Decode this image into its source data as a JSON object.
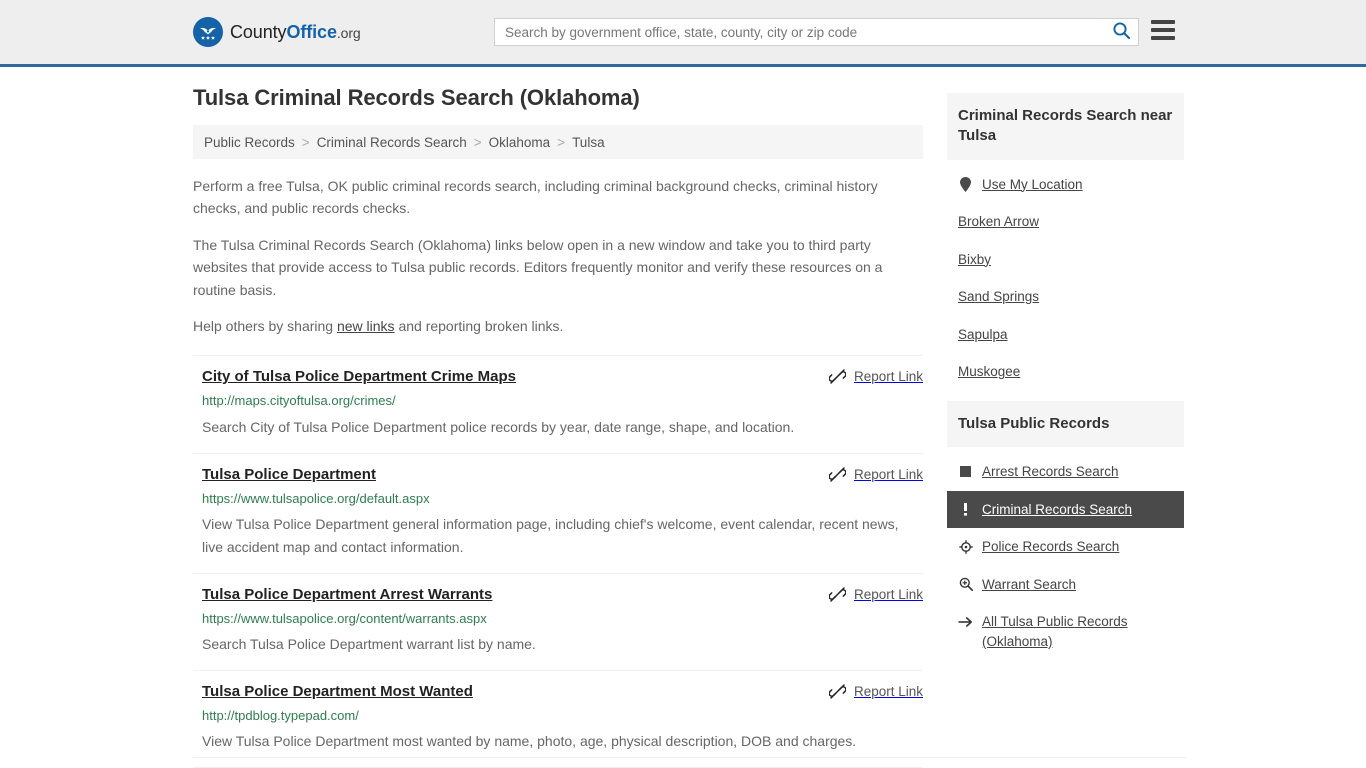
{
  "header": {
    "logo": {
      "icon": "eagle-shield-icon",
      "text_part1": "County",
      "text_part2": "Office",
      "text_part3": ".org"
    },
    "search": {
      "placeholder": "Search by government office, state, county, city or zip code",
      "value": "",
      "icon": "search-icon",
      "accent": "#1463a8"
    },
    "menu_icon": "hamburger-menu-icon",
    "background": "#eeeeee",
    "border_color": "#30699b"
  },
  "main": {
    "title": "Tulsa Criminal Records Search (Oklahoma)",
    "breadcrumb": {
      "items": [
        {
          "label": "Public Records",
          "current": false
        },
        {
          "label": "Criminal Records Search",
          "current": false
        },
        {
          "label": "Oklahoma",
          "current": false
        },
        {
          "label": "Tulsa",
          "current": true
        }
      ],
      "separator": ">"
    },
    "intro": {
      "paragraph1": "Perform a free Tulsa, OK public criminal records search, including criminal background checks, criminal history checks, and public records checks.",
      "paragraph2": "The Tulsa Criminal Records Search (Oklahoma) links below open in a new window and take you to third party websites that provide access to Tulsa public records. Editors frequently monitor and verify these resources on a routine basis.",
      "paragraph3_before": "Help others by sharing ",
      "paragraph3_link": "new links",
      "paragraph3_after": " and reporting broken links."
    },
    "report_link_label": "Report Link",
    "report_link_icon": "broken-link-icon",
    "results": [
      {
        "title": "City of Tulsa Police Department Crime Maps",
        "url": "http://maps.cityoftulsa.org/crimes/",
        "description": "Search City of Tulsa Police Department police records by year, date range, shape, and location."
      },
      {
        "title": "Tulsa Police Department",
        "url": "https://www.tulsapolice.org/default.aspx",
        "description": "View Tulsa Police Department general information page, including chief's welcome, event calendar, recent news, live accident map and contact information."
      },
      {
        "title": "Tulsa Police Department Arrest Warrants",
        "url": "https://www.tulsapolice.org/content/warrants.aspx",
        "description": "Search Tulsa Police Department warrant list by name."
      },
      {
        "title": "Tulsa Police Department Most Wanted",
        "url": "http://tpdblog.typepad.com/",
        "description": "View Tulsa Police Department most wanted by name, photo, age, physical description, DOB and charges."
      }
    ]
  },
  "sidebar": {
    "nearby": {
      "title": "Criminal Records Search near Tulsa",
      "items": [
        {
          "label": "Use My Location",
          "icon": "map-pin-icon",
          "has_icon": true
        },
        {
          "label": "Broken Arrow",
          "icon": "",
          "has_icon": false
        },
        {
          "label": "Bixby",
          "icon": "",
          "has_icon": false
        },
        {
          "label": "Sand Springs",
          "icon": "",
          "has_icon": false
        },
        {
          "label": "Sapulpa",
          "icon": "",
          "has_icon": false
        },
        {
          "label": "Muskogee",
          "icon": "",
          "has_icon": false
        }
      ]
    },
    "public_records": {
      "title": "Tulsa Public Records",
      "active_background": "#4a4a4a",
      "items": [
        {
          "label": "Arrest Records Search",
          "icon": "filled-square-icon",
          "active": false
        },
        {
          "label": "Criminal Records Search",
          "icon": "exclamation-icon",
          "active": true
        },
        {
          "label": "Police Records Search",
          "icon": "crosshair-icon",
          "active": false
        },
        {
          "label": "Warrant Search",
          "icon": "magnifier-plus-icon",
          "active": false
        },
        {
          "label": "All Tulsa Public Records (Oklahoma)",
          "icon": "arrow-right-icon",
          "active": false
        }
      ]
    }
  }
}
